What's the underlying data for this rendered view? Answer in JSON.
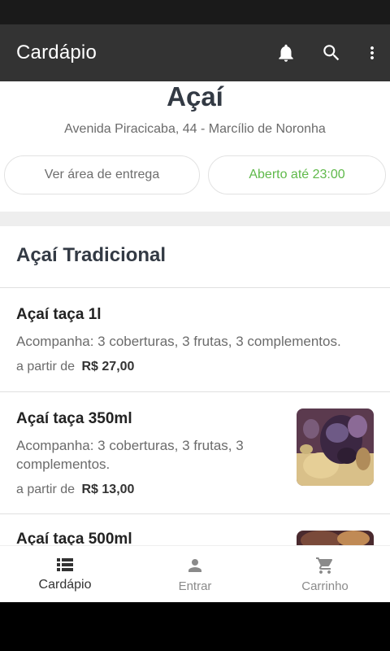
{
  "app_bar": {
    "title": "Cardápio",
    "icons": [
      "bell-icon",
      "search-icon",
      "more-vert-icon"
    ]
  },
  "store": {
    "name": "Açaí",
    "address": "Avenida Piracicaba, 44 - Marcílio de Noronha",
    "delivery_button": "Ver área de entrega",
    "open_status": "Aberto até 23:00"
  },
  "category": {
    "title": "Açaí Tradicional",
    "items": [
      {
        "name": "Açaí taça 1l",
        "description": "Acompanha: 3 coberturas, 3 frutas, 3 complementos.",
        "price_prefix": "a partir de",
        "price": "R$ 27,00"
      },
      {
        "name": "Açaí taça 350ml",
        "description_line1": "Acompanha: 3 coberturas, 3 frutas, 3",
        "description_line2": "complementos.",
        "price_prefix": "a partir de",
        "price": "R$ 13,00"
      },
      {
        "name": "Açaí taça 500ml"
      }
    ]
  },
  "bottom_nav": {
    "items": [
      {
        "label": "Cardápio",
        "icon": "menu-list-icon",
        "active": true
      },
      {
        "label": "Entrar",
        "icon": "person-icon",
        "active": false
      },
      {
        "label": "Carrinho",
        "icon": "cart-icon",
        "active": false
      }
    ]
  },
  "colors": {
    "app_bar": "#333333",
    "open_status": "#5fb94a",
    "title_text": "#333a44"
  }
}
